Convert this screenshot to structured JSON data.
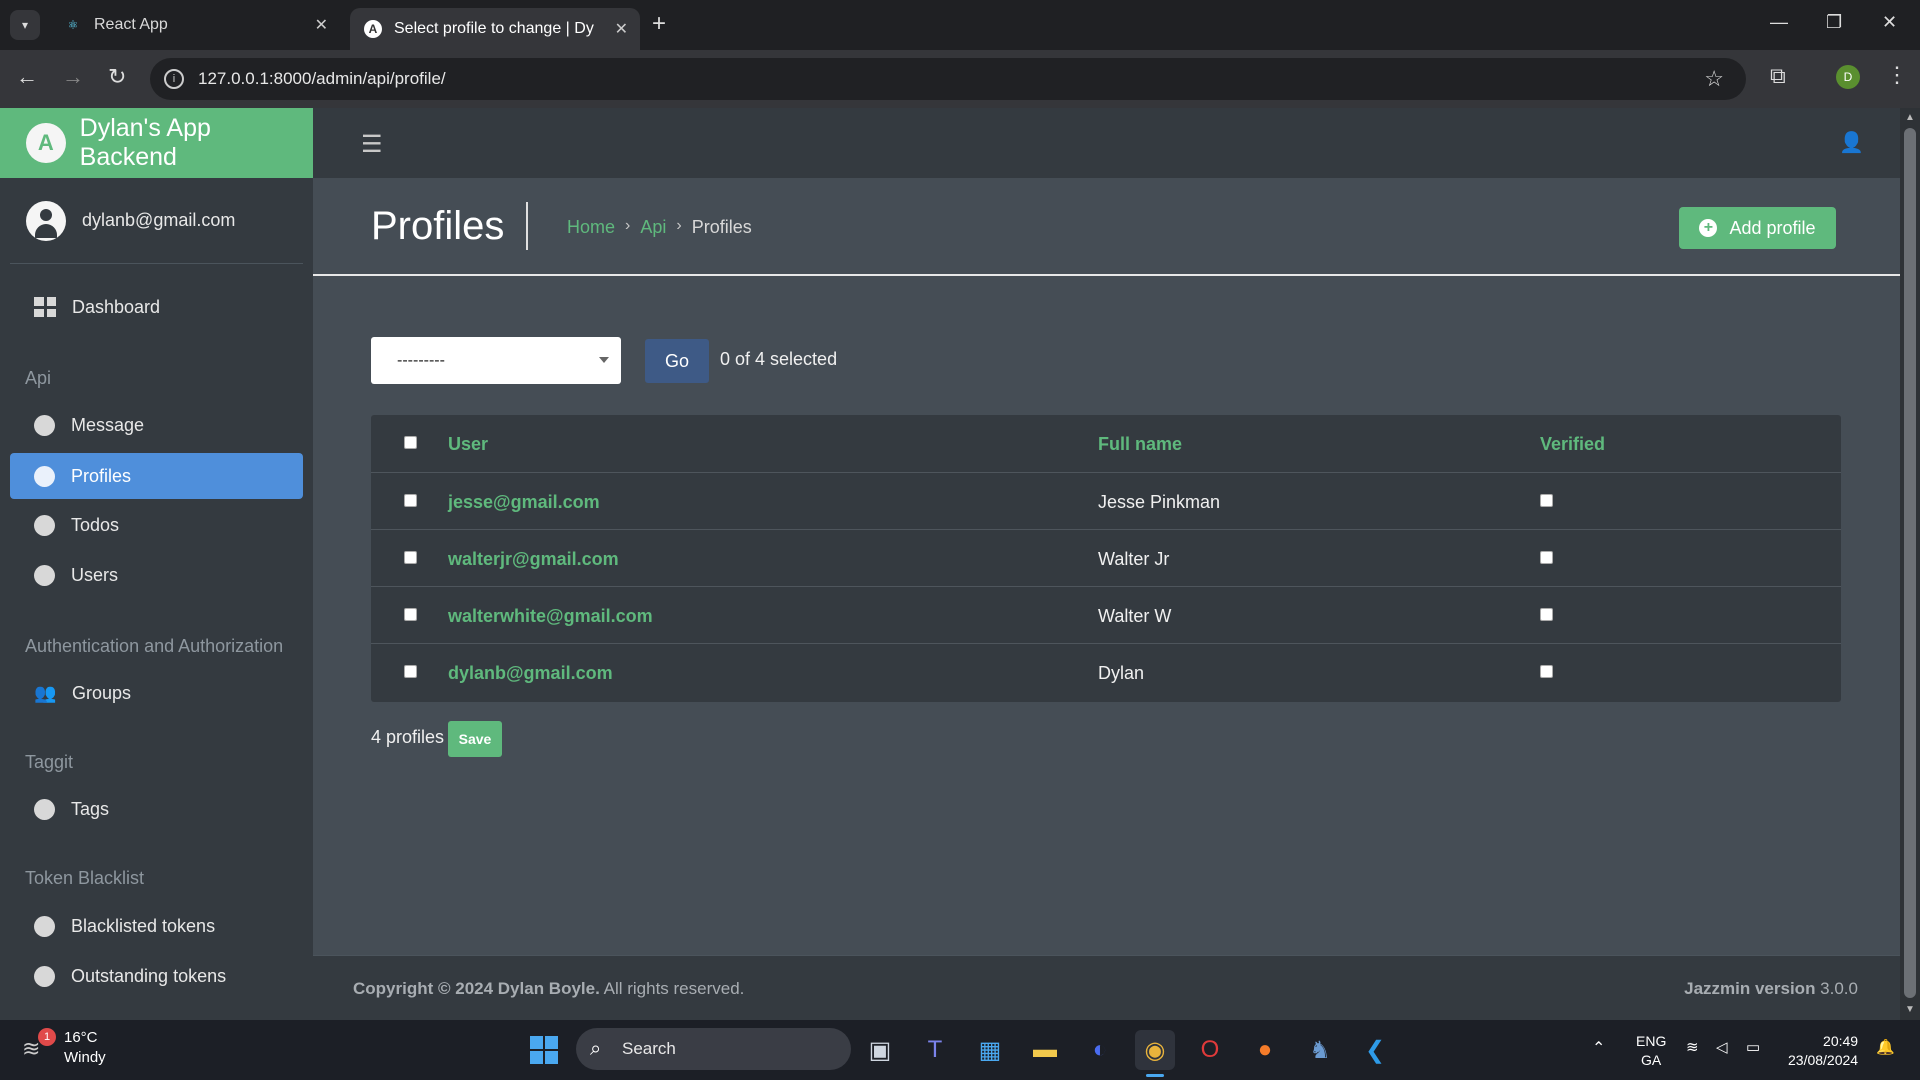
{
  "browser": {
    "tabs": [
      {
        "label": "React App"
      },
      {
        "label": "Select profile to change | Dylan"
      }
    ],
    "url": "127.0.0.1:8000/admin/api/profile/"
  },
  "brand": {
    "title": "Dylan's App Backend"
  },
  "user": {
    "email": "dylanb@gmail.com"
  },
  "sidebar": {
    "dashboard": "Dashboard",
    "sections": [
      {
        "header": "Api",
        "items": [
          "Message",
          "Profiles",
          "Todos",
          "Users"
        ]
      },
      {
        "header": "Authentication and Authorization",
        "items": [
          "Groups"
        ]
      },
      {
        "header": "Taggit",
        "items": [
          "Tags"
        ]
      },
      {
        "header": "Token Blacklist",
        "items": [
          "Blacklisted tokens",
          "Outstanding tokens"
        ]
      }
    ],
    "active": "Profiles"
  },
  "header": {
    "title": "Profiles",
    "breadcrumb": [
      "Home",
      "Api",
      "Profiles"
    ],
    "add_button": "Add profile"
  },
  "actions": {
    "select_value": "---------",
    "go_label": "Go",
    "selected_text": "0 of 4 selected"
  },
  "table": {
    "columns": [
      "User",
      "Full name",
      "Verified"
    ],
    "rows": [
      {
        "user": "jesse@gmail.com",
        "full_name": "Jesse Pinkman"
      },
      {
        "user": "walterjr@gmail.com",
        "full_name": "Walter Jr"
      },
      {
        "user": "walterwhite@gmail.com",
        "full_name": "Walter W"
      },
      {
        "user": "dylanb@gmail.com",
        "full_name": "Dylan"
      }
    ]
  },
  "results": {
    "count_text": "4 profiles",
    "save_label": "Save"
  },
  "footer": {
    "copyright_prefix": "Copyright © 2024 Dylan Boyle.",
    "copyright_suffix": " All rights reserved.",
    "version_label": "Jazzmin version",
    "version_value": " 3.0.0"
  },
  "taskbar": {
    "weather_temp": "16°C",
    "weather_desc": "Windy",
    "weather_badge": "1",
    "search_placeholder": "Search",
    "lang_1": "ENG",
    "lang_2": "GA",
    "time": "20:49",
    "date": "23/08/2024"
  },
  "colors": {
    "brand_green": "#5fb97d",
    "active_blue": "#4f8fdb",
    "sidebar_bg": "#343a40",
    "content_bg": "#454d55"
  }
}
